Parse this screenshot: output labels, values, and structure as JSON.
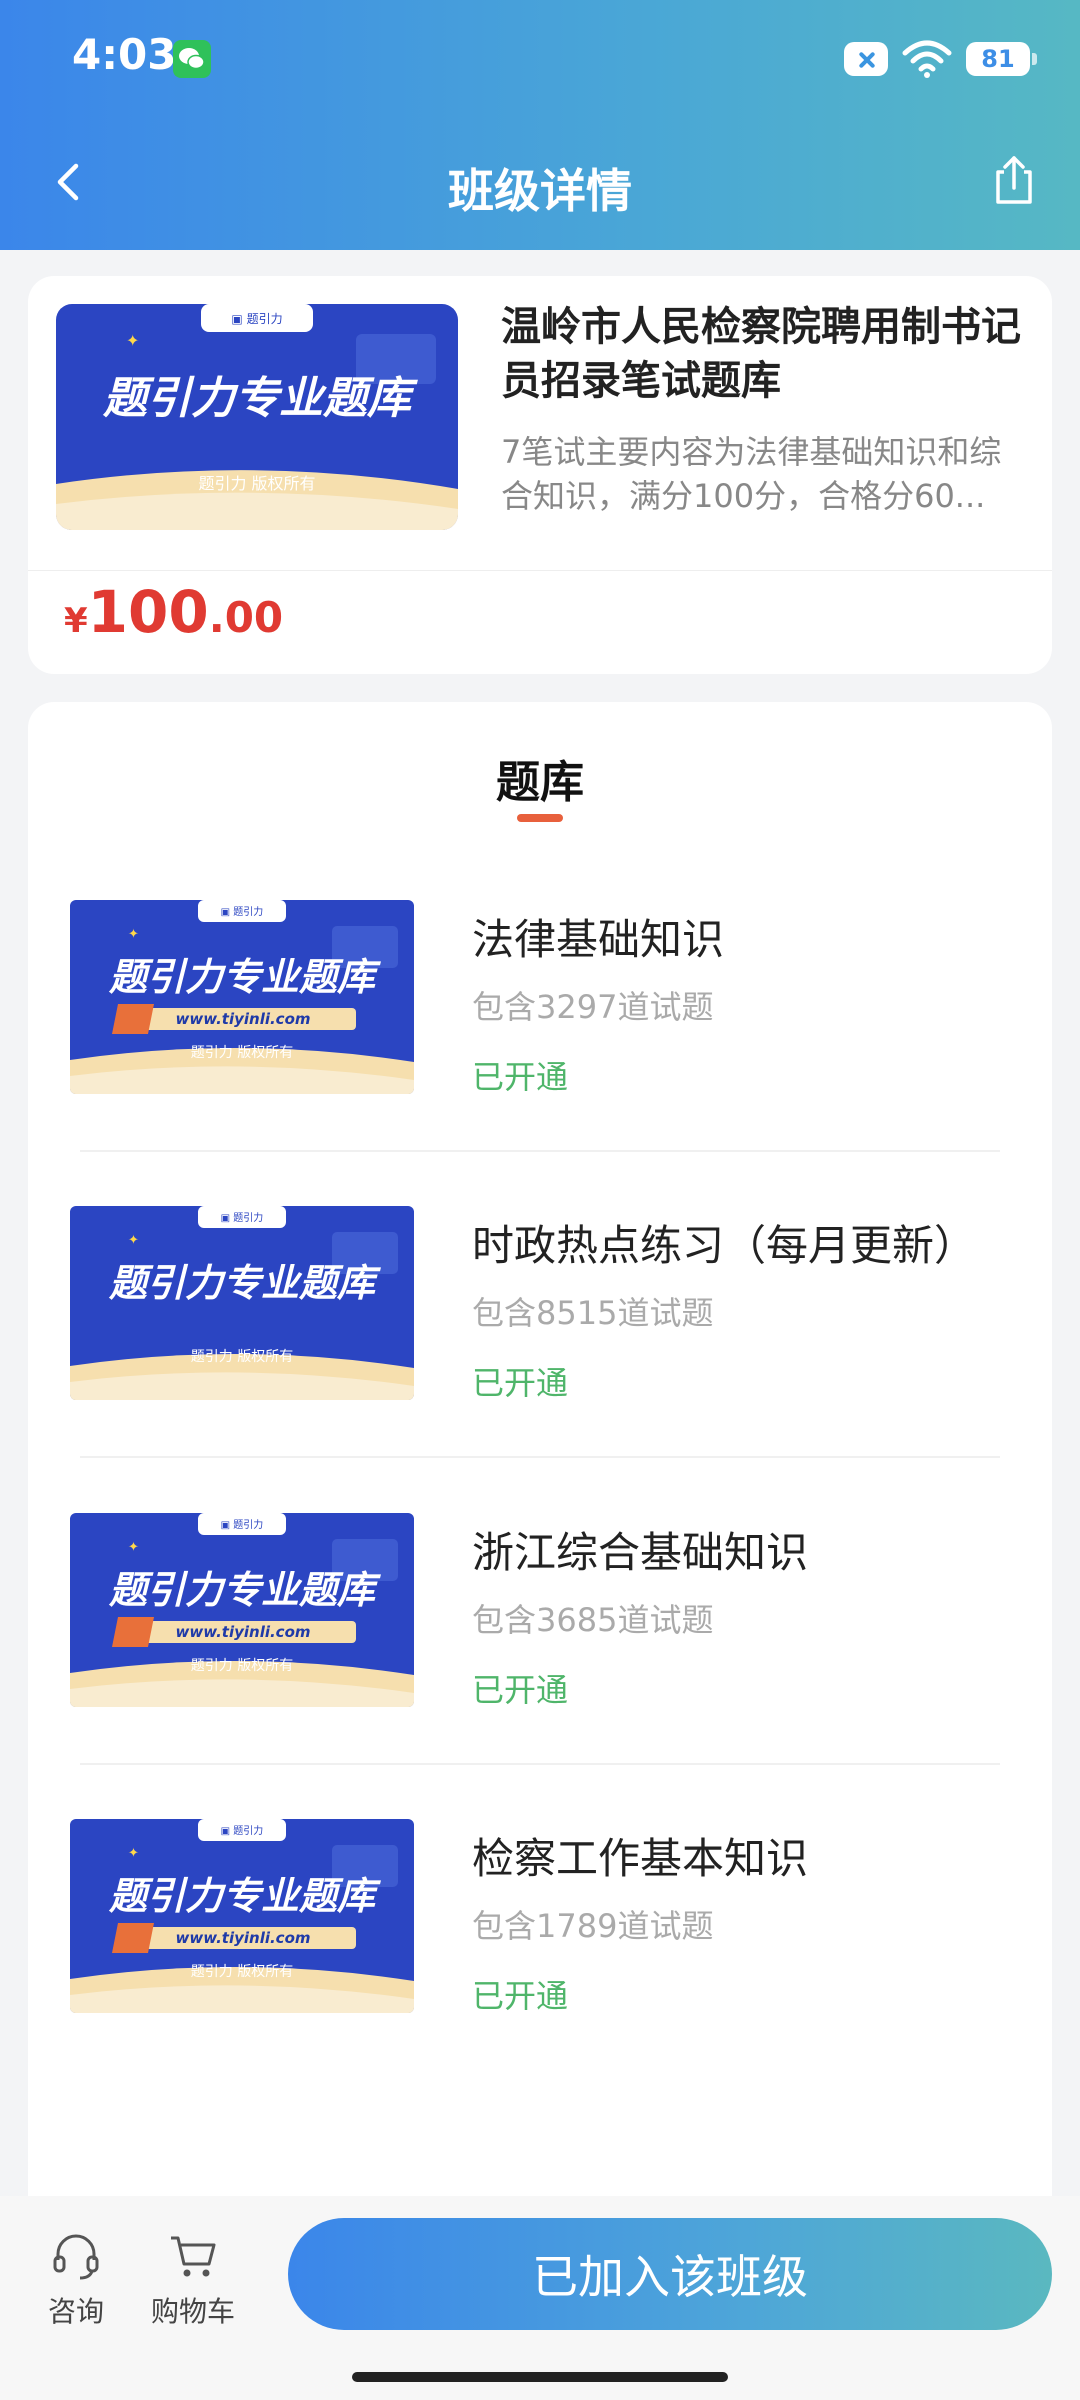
{
  "status_bar": {
    "time": "4:03",
    "battery": "81"
  },
  "nav": {
    "title": "班级详情"
  },
  "class_card": {
    "banner": {
      "headline": "题引力专业题库",
      "logo_text": "题引力",
      "copyright": "题引力 版权所有"
    },
    "title": "温岭市人民检察院聘用制书记员招录笔试题库",
    "description": "7笔试主要内容为法律基础知识和综合知识，满分100分，合格分60...",
    "price": {
      "symbol": "¥",
      "integer": "100",
      "decimal": ".00"
    }
  },
  "bank": {
    "heading": "题库",
    "items": [
      {
        "name": "法律基础知识",
        "count": "包含3297道试题",
        "status": "已开通",
        "url": "www.tiyinli.com"
      },
      {
        "name": "时政热点练习（每月更新）",
        "count": "包含8515道试题",
        "status": "已开通",
        "url": ""
      },
      {
        "name": "浙江综合基础知识",
        "count": "包含3685道试题",
        "status": "已开通",
        "url": "www.tiyinli.com"
      },
      {
        "name": "检察工作基本知识",
        "count": "包含1789道试题",
        "status": "已开通",
        "url": "www.tiyinli.com"
      }
    ],
    "thumb": {
      "headline": "题引力专业题库",
      "logo_text": "题引力",
      "copyright": "题引力 版权所有"
    }
  },
  "bottom_bar": {
    "consult_label": "咨询",
    "cart_label": "购物车",
    "join_label": "已加入该班级"
  },
  "colors": {
    "accent_start": "#3b86ea",
    "accent_end": "#56b8c4",
    "price": "#e03a32",
    "status_open": "#4fb56a"
  }
}
